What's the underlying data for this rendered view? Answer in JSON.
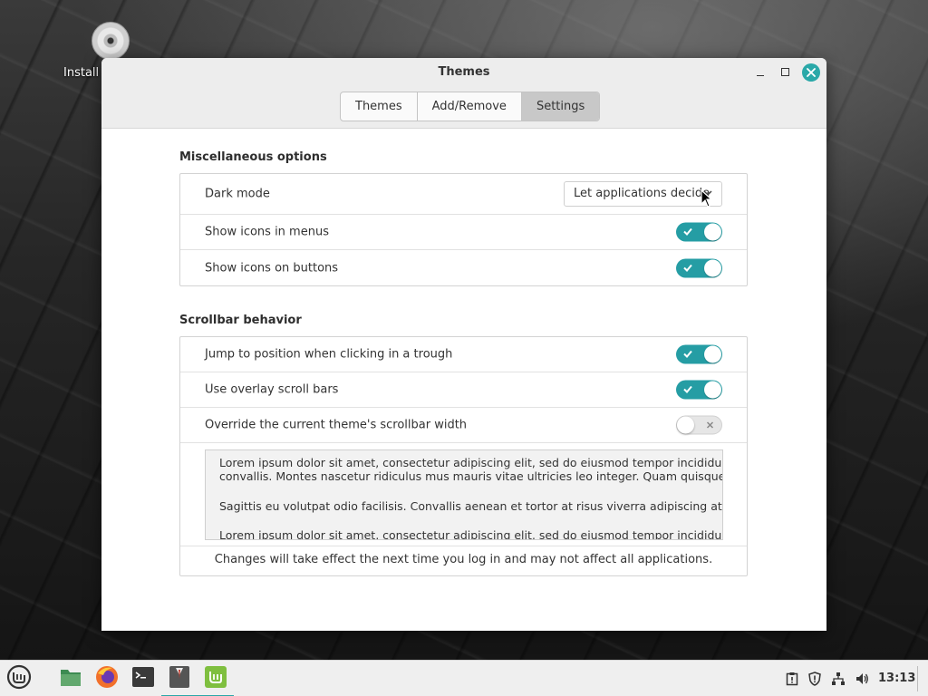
{
  "desktop": {
    "icon_label": "Install"
  },
  "window": {
    "title": "Themes",
    "tabs": [
      {
        "label": "Themes",
        "active": false
      },
      {
        "label": "Add/Remove",
        "active": false
      },
      {
        "label": "Settings",
        "active": true
      }
    ]
  },
  "misc": {
    "title": "Miscellaneous options",
    "dark_mode_label": "Dark mode",
    "dark_mode_value": "Let applications decide",
    "show_icons_menus_label": "Show icons in menus",
    "show_icons_menus_on": true,
    "show_icons_buttons_label": "Show icons on buttons",
    "show_icons_buttons_on": true
  },
  "scrollbar": {
    "title": "Scrollbar behavior",
    "jump_label": "Jump to position when clicking in a trough",
    "jump_on": true,
    "overlay_label": "Use overlay scroll bars",
    "overlay_on": true,
    "override_label": "Override the current theme's scrollbar width",
    "override_on": false,
    "preview_line1": "Lorem ipsum dolor sit amet, consectetur adipiscing elit, sed do eiusmod tempor incididunt ut labore",
    "preview_line2": "convallis. Montes nascetur ridiculus mus mauris vitae ultricies leo integer. Quam quisque id diam",
    "preview_line3": "Sagittis eu volutpat odio facilisis. Convallis aenean et tortor at risus viverra adipiscing at. Sapien",
    "preview_line4": "Lorem ipsum dolor sit amet, consectetur adipiscing elit, sed do eiusmod tempor incididunt ut labore",
    "footer_note": "Changes will take effect the next time you log in and may not affect all applications."
  },
  "taskbar": {
    "clock": "13:13",
    "apps": [
      "menu-icon",
      "files-icon",
      "firefox-icon",
      "terminal-icon",
      "themes-icon",
      "mintupdate-icon"
    ],
    "accent": "#29a8a8"
  },
  "colors": {
    "switch_on": "#259da4",
    "close_button": "#2aa8a8"
  }
}
